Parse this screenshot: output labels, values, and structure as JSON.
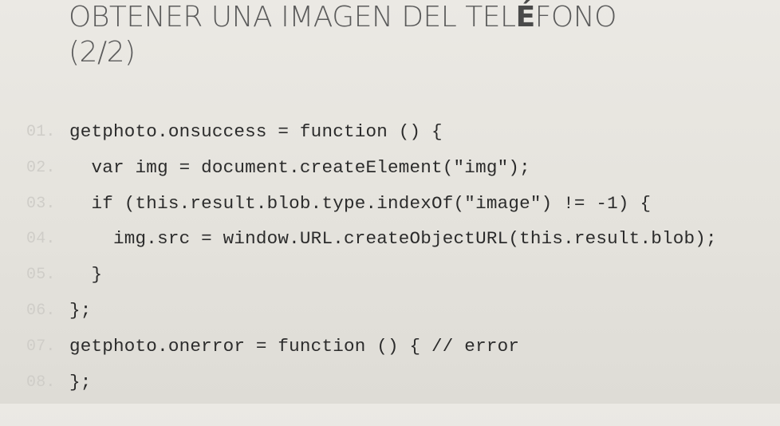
{
  "title": {
    "line1_before": "OBTENER UNA IMAGEN DEL TEL",
    "line1_bold": "É",
    "line1_after": "FONO",
    "line2": "(2/2)"
  },
  "code": {
    "lines": [
      {
        "num": "01.",
        "text": "getphoto.onsuccess = function () {"
      },
      {
        "num": "02.",
        "text": "  var img = document.createElement(\"img\");"
      },
      {
        "num": "03.",
        "text": "  if (this.result.blob.type.indexOf(\"image\") != -1) {"
      },
      {
        "num": "04.",
        "text": "    img.src = window.URL.createObjectURL(this.result.blob);"
      },
      {
        "num": "05.",
        "text": "  }"
      },
      {
        "num": "06.",
        "text": "};"
      },
      {
        "num": "07.",
        "text": "getphoto.onerror = function () { // error"
      },
      {
        "num": "08.",
        "text": "};"
      }
    ]
  },
  "colors": {
    "title": "#5b5b5b",
    "code_text": "#2b2b2b",
    "line_numbers": "#cfcdc8",
    "background": "#e6e4de"
  }
}
